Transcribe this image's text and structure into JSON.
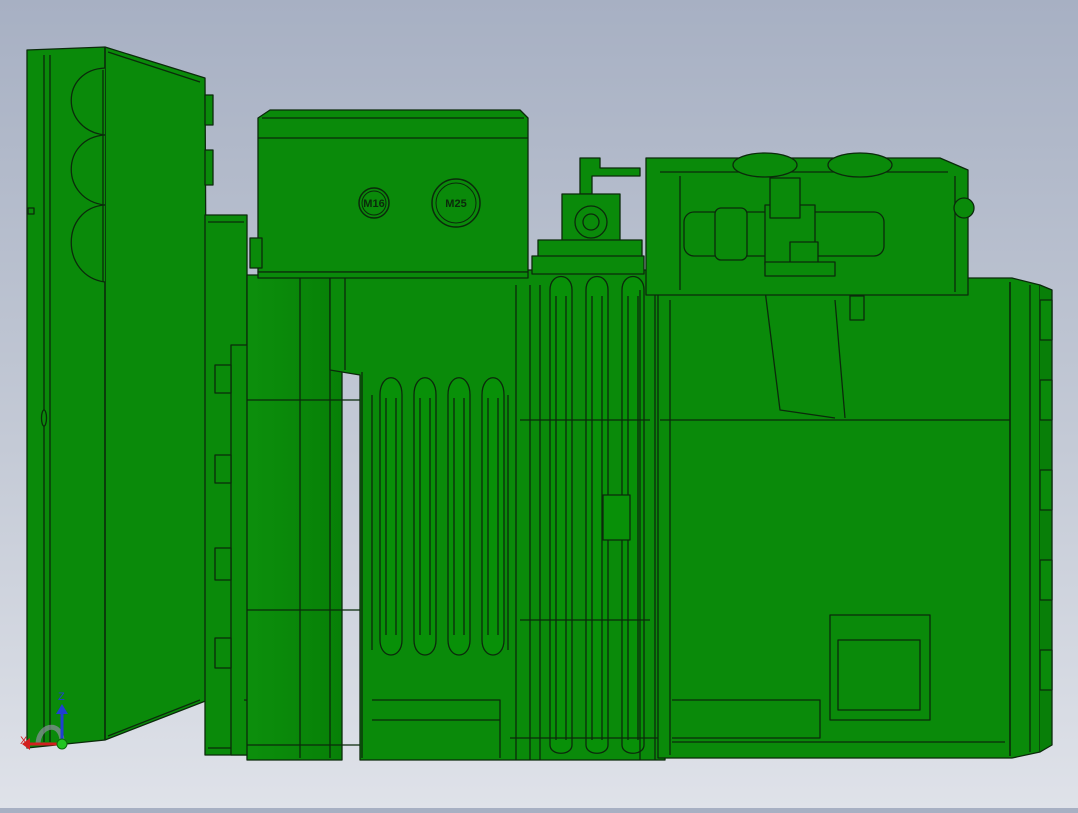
{
  "viewport": {
    "background_top": "#a7b0c3",
    "background_bottom": "#dfe2e9"
  },
  "model": {
    "body_color": "#0a8a0a",
    "edge_color": "#0b2a0b",
    "shade_color": "#067206",
    "highlight_color": "#1aa51a"
  },
  "terminal_box": {
    "glands": [
      {
        "label": "M16"
      },
      {
        "label": "M25"
      }
    ]
  },
  "triad": {
    "x_label": "X",
    "z_label": "Z",
    "x_color": "#d21f1f",
    "z_color": "#1f3fd2",
    "origin_color": "#21c521"
  }
}
